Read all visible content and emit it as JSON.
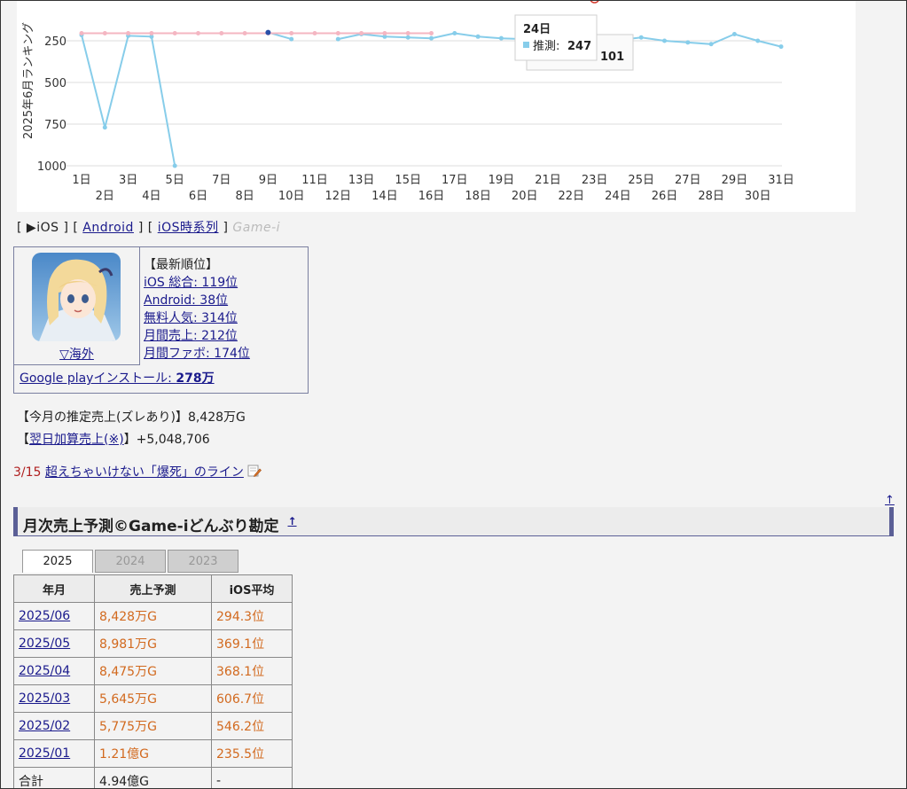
{
  "chart": {
    "y_axis_label": "2025年6月ランキング",
    "y_ticks": [
      "250",
      "500",
      "750",
      "1000"
    ],
    "x_labels": [
      "1日",
      "2日",
      "3日",
      "4日",
      "5日",
      "6日",
      "7日",
      "8日",
      "9日",
      "10日",
      "11日",
      "12日",
      "13日",
      "14日",
      "15日",
      "16日",
      "17日",
      "18日",
      "19日",
      "20日",
      "21日",
      "22日",
      "23日",
      "24日",
      "25日",
      "26日",
      "27日",
      "28日",
      "29日",
      "30日",
      "31日"
    ],
    "tooltip": {
      "title": "24日",
      "series_label": "推測:",
      "value": "247"
    },
    "tooltip_behind_value": "101",
    "colors": {
      "ios": "#87cdea",
      "android": "#f4b6c2",
      "highlight": "#d43b2f",
      "grid": "#dddddd"
    }
  },
  "chart_data": {
    "type": "line",
    "ylabel": "2025年6月ランキング",
    "xlabel": "",
    "ylim": [
      1000,
      0
    ],
    "categories": [
      "1日",
      "2日",
      "3日",
      "4日",
      "5日",
      "6日",
      "7日",
      "8日",
      "9日",
      "10日",
      "11日",
      "12日",
      "13日",
      "14日",
      "15日",
      "16日",
      "17日",
      "18日",
      "19日",
      "20日",
      "21日",
      "22日",
      "23日",
      "24日",
      "25日",
      "26日",
      "27日",
      "28日",
      "29日",
      "30日",
      "31日"
    ],
    "series": [
      {
        "values": [
          215,
          770,
          220,
          225,
          1000,
          null,
          null,
          null,
          200,
          240,
          null,
          240,
          210,
          225,
          230,
          235,
          205,
          225,
          235,
          240,
          235,
          225,
          230,
          247,
          230,
          250,
          260,
          270,
          210,
          250,
          285
        ]
      },
      {
        "values": [
          205,
          205,
          205,
          205,
          205,
          205,
          205,
          205,
          205,
          205,
          205,
          205,
          205,
          205,
          205,
          205,
          null,
          null,
          null,
          null,
          null,
          null,
          null,
          null,
          null,
          null,
          null,
          null,
          null,
          null,
          null
        ]
      },
      {
        "values": [
          null,
          null,
          null,
          null,
          null,
          null,
          null,
          null,
          null,
          null,
          null,
          null,
          null,
          null,
          null,
          null,
          null,
          null,
          null,
          null,
          -20,
          -25,
          -5,
          null,
          null,
          null,
          null,
          null,
          null,
          null,
          null
        ]
      }
    ],
    "grid": true
  },
  "nav": {
    "open": "[",
    "close": "]",
    "ios": "▶iOS",
    "android": "Android",
    "ios_timeseries": "iOS時系列",
    "brand": "Game-i"
  },
  "app": {
    "region_link": "▽海外",
    "rank_title": "【最新順位】",
    "ranks": [
      "iOS 総合: 119位",
      "Android: 38位",
      "無料人気: 314位",
      "月間売上: 212位",
      "月間ファボ: 174位"
    ],
    "install_label": "Google playインストール: ",
    "install_value": "278万"
  },
  "sales": {
    "estimate_label": "【今月の推定売上(ズレあり)】",
    "estimate_value": "8,428万G",
    "next_day_open": "【",
    "next_day_link": "翌日加算売上(※)",
    "next_day_close": "】",
    "next_day_value": "+5,048,706"
  },
  "notice": {
    "date": "3/15",
    "text": "超えちゃいけない「爆死」のライン"
  },
  "section": {
    "title": "月次売上予測©Game-iどんぶり勘定",
    "title_link": "↑",
    "up_arrow": "↑"
  },
  "year_tabs": [
    "2025",
    "2024",
    "2023"
  ],
  "table": {
    "headers": [
      "年月",
      "売上予測",
      "iOS平均"
    ],
    "rows": [
      {
        "month": "2025/06",
        "sales": "8,428万G",
        "ios": "294.3位"
      },
      {
        "month": "2025/05",
        "sales": "8,981万G",
        "ios": "369.1位"
      },
      {
        "month": "2025/04",
        "sales": "8,475万G",
        "ios": "368.1位"
      },
      {
        "month": "2025/03",
        "sales": "5,645万G",
        "ios": "606.7位"
      },
      {
        "month": "2025/02",
        "sales": "5,775万G",
        "ios": "546.2位"
      },
      {
        "month": "2025/01",
        "sales": "1.21億G",
        "ios": "235.5位"
      }
    ],
    "total": {
      "label": "合計",
      "sales": "4.94億G",
      "ios": "-"
    }
  }
}
